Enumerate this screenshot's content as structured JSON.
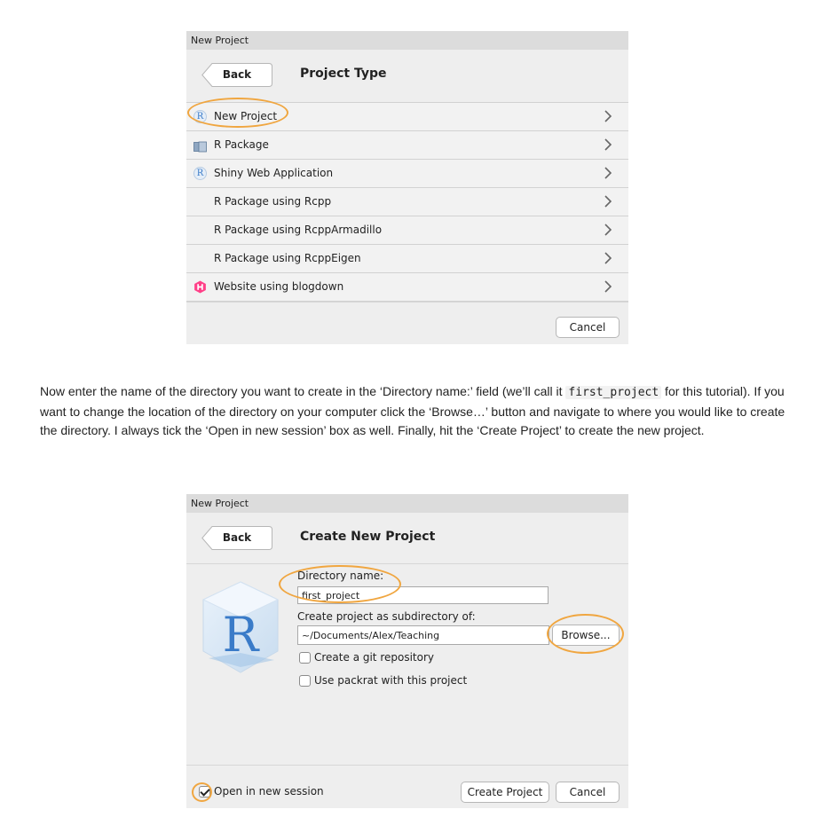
{
  "dialog1": {
    "window_title": "New Project",
    "back_label": "Back",
    "page_title": "Project Type",
    "items": [
      {
        "label": "New Project",
        "icon": "r-logo-icon"
      },
      {
        "label": "R Package",
        "icon": "package-icon"
      },
      {
        "label": "Shiny Web Application",
        "icon": "r-logo-icon"
      },
      {
        "label": "R Package using Rcpp",
        "icon": ""
      },
      {
        "label": "R Package using RcppArmadillo",
        "icon": ""
      },
      {
        "label": "R Package using RcppEigen",
        "icon": ""
      },
      {
        "label": "Website using blogdown",
        "icon": "hugo-icon"
      }
    ],
    "chevron": ">",
    "cancel_label": "Cancel"
  },
  "paragraph": {
    "text_before": "Now enter the name of the directory you want to create in the ‘Directory name:’ field (we’ll call it ",
    "code": "first_project",
    "text_after": " for this tutorial). If you want to change the location of the directory on your computer click the ‘Browse…’ button and navigate to where you would like to create the directory. I always tick the ‘Open in new session’ box as well. Finally, hit the ‘Create Project’ to create the new project."
  },
  "dialog2": {
    "window_title": "New Project",
    "back_label": "Back",
    "page_title": "Create New Project",
    "directory_label": "Directory name:",
    "directory_value": "first_project",
    "subdir_label": "Create project as subdirectory of:",
    "subdir_value": "~/Documents/Alex/Teaching",
    "browse_label": "Browse...",
    "git_label": "Create a git repository",
    "git_checked": false,
    "packrat_label": "Use packrat with this project",
    "packrat_checked": false,
    "open_session_label": "Open in new session",
    "open_session_checked": true,
    "create_label": "Create Project",
    "cancel_label": "Cancel"
  },
  "colors": {
    "highlight_ring": "#f0a640",
    "dialog_bg": "#eeeeee",
    "titlebar_bg": "#dcdcdc",
    "r_blue": "#3a7bc8",
    "hugo_pink": "#ff4088"
  }
}
